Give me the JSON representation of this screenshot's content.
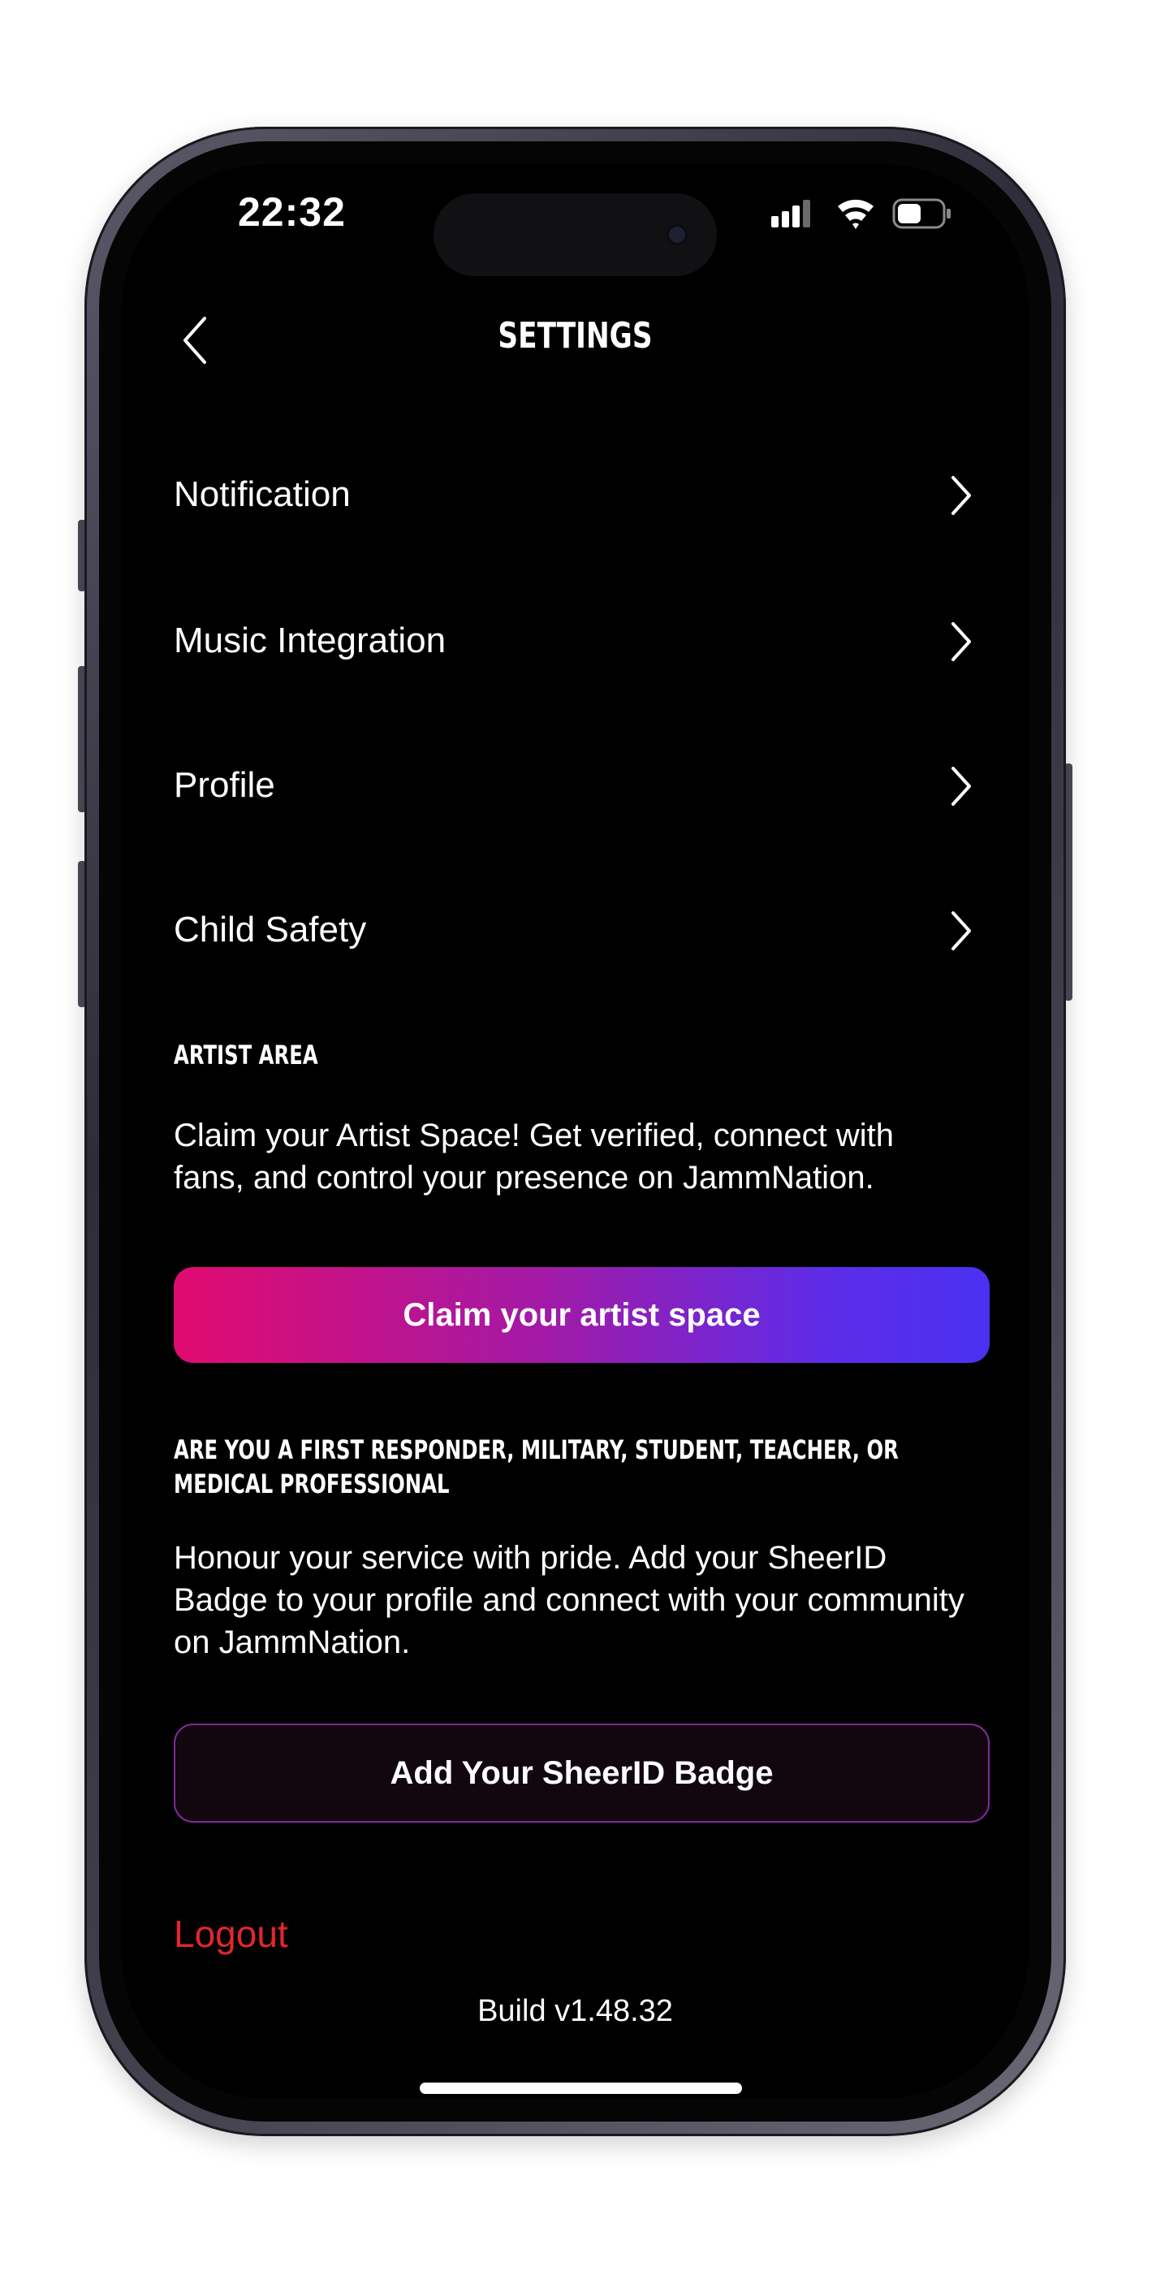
{
  "status_bar": {
    "time": "22:32",
    "icons": [
      "cellular-signal-icon",
      "wifi-icon",
      "battery-icon"
    ]
  },
  "header": {
    "title": "SETTINGS",
    "back_icon": "chevron-left-icon"
  },
  "menu": {
    "items": [
      {
        "label": "Notification"
      },
      {
        "label": "Music Integration"
      },
      {
        "label": "Profile"
      },
      {
        "label": "Child Safety"
      }
    ]
  },
  "artist_area": {
    "heading": "ARTIST AREA",
    "body": "Claim your Artist Space! Get verified, connect with fans, and control your presence on JammNation.",
    "button_label": "Claim your artist space"
  },
  "sheerid": {
    "heading": "ARE YOU A FIRST RESPONDER, MILITARY, STUDENT, TEACHER, OR MEDICAL PROFESSIONAL",
    "body": "Honour your service with pride. Add your SheerID Badge to your profile and connect with your community on JammNation.",
    "button_label": "Add Your SheerID Badge"
  },
  "footer": {
    "logout_label": "Logout",
    "build_label": "Build v1.48.32"
  },
  "colors": {
    "background": "#000000",
    "logout": "#e0262e",
    "gradient_start": "#e10b6f",
    "gradient_end": "#4b31f2",
    "sheer_border": "#7f2a9c"
  }
}
